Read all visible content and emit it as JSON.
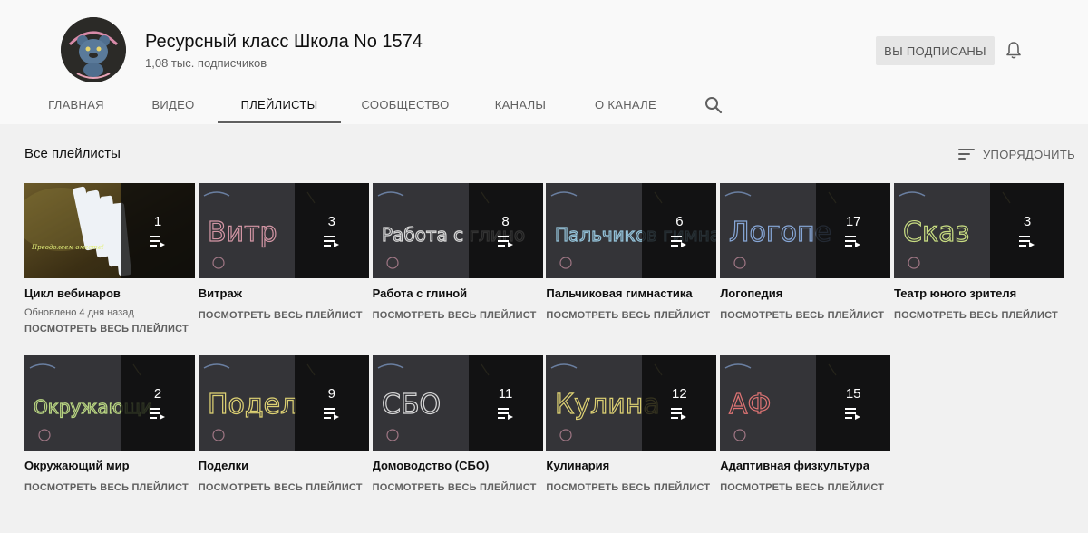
{
  "channel": {
    "name": "Ресурсный класс Школа No 1574",
    "subscribers": "1,08 тыс. подписчиков",
    "subscribe_label": "ВЫ ПОДПИСАНЫ",
    "avatar_icon": "bear-logo-icon"
  },
  "tabs": [
    {
      "label": "ГЛАВНАЯ",
      "active": false
    },
    {
      "label": "ВИДЕО",
      "active": false
    },
    {
      "label": "ПЛЕЙЛИСТЫ",
      "active": true
    },
    {
      "label": "СООБЩЕСТВО",
      "active": false
    },
    {
      "label": "КАНАЛЫ",
      "active": false
    },
    {
      "label": "О КАНАЛЕ",
      "active": false
    }
  ],
  "section": {
    "title": "Все плейлисты",
    "sort_label": "УПОРЯДОЧИТЬ"
  },
  "view_all_label": "ПОСМОТРЕТЬ ВЕСЬ ПЛЕЙЛИСТ",
  "playlists": [
    {
      "title": "Цикл вебинаров",
      "count": "1",
      "updated": "Обновлено 4 дня назад",
      "thumb_text": "Преодолеем вместе!",
      "thumb_style": "webinar"
    },
    {
      "title": "Витраж",
      "count": "3",
      "thumb_text": "Витр",
      "thumb_style": "chalk",
      "chalk_color": "#e4a0b0"
    },
    {
      "title": "Работа с глиной",
      "count": "8",
      "thumb_text": "Работа с глино",
      "thumb_style": "chalk",
      "chalk_color": "#e8e8e8"
    },
    {
      "title": "Пальчиковая гимнастика",
      "count": "6",
      "thumb_text": "Пальчиков гимна",
      "thumb_style": "chalk",
      "chalk_color": "#9fd3ec"
    },
    {
      "title": "Логопедия",
      "count": "17",
      "thumb_text": "Логопе",
      "thumb_style": "chalk",
      "chalk_color": "#8fb3e8"
    },
    {
      "title": "Театр юного зрителя",
      "count": "3",
      "thumb_text": "Сказ",
      "thumb_style": "chalk",
      "chalk_color": "#d9f08a"
    },
    {
      "title": "Окружающий мир",
      "count": "2",
      "thumb_text": "Окружающи",
      "thumb_style": "chalk",
      "chalk_color": "#c7e68a"
    },
    {
      "title": "Поделки",
      "count": "9",
      "thumb_text": "Подел",
      "thumb_style": "chalk",
      "chalk_color": "#f0e27a"
    },
    {
      "title": "Домоводство (СБО)",
      "count": "11",
      "thumb_text": "СБО",
      "thumb_style": "chalk",
      "chalk_color": "#e8e8e8"
    },
    {
      "title": "Кулинария",
      "count": "12",
      "thumb_text": "Кулина",
      "thumb_style": "chalk",
      "chalk_color": "#f0e27a"
    },
    {
      "title": "Адаптивная физкультура",
      "count": "15",
      "thumb_text": "АФ",
      "thumb_style": "chalk",
      "chalk_color": "#f07a7a"
    }
  ],
  "colors": {
    "header_bg": "#f9f9f9",
    "page_bg": "#f1f1f1",
    "text_primary": "#0f0f0f",
    "text_secondary": "#606060"
  }
}
